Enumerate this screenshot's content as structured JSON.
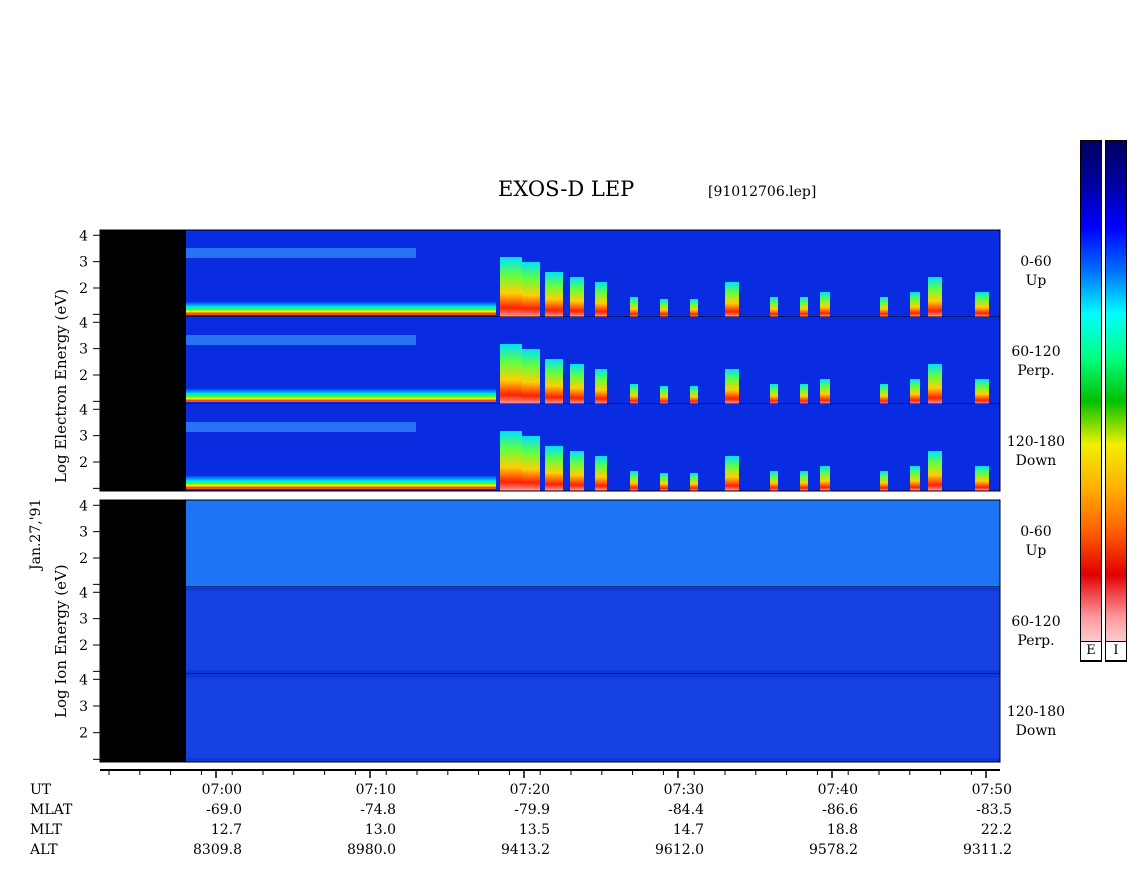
{
  "title": "EXOS-D LEP",
  "subtitle": "[91012706.lep]",
  "date_label": "Jan.27,'91",
  "electron_axis_label": "Log  Electron  Energy (eV)",
  "ion_axis_label": "Log  Ion  Energy (eV)",
  "colorbar_labels": [
    "E",
    "I"
  ],
  "colorbar_colors": [
    "#f5f5f5",
    "#ff9aa0",
    "#e00000",
    "#ff6000",
    "#ffb000",
    "#f0f000",
    "#00c000",
    "#00ff80",
    "#00ffff",
    "#0070ff",
    "#0000ff",
    "#0000a0",
    "#000060"
  ],
  "row_labels": [
    "UT",
    "MLAT",
    "MLT",
    "ALT"
  ],
  "ut_ticks": [
    "07:00",
    "07:10",
    "07:20",
    "07:30",
    "07:40",
    "07:50"
  ],
  "mlat": [
    "-69.0",
    "-74.8",
    "-79.9",
    "-84.4",
    "-86.6",
    "-83.5"
  ],
  "mlt": [
    "12.7",
    "13.0",
    "13.5",
    "14.7",
    "18.8",
    "22.2"
  ],
  "alt": [
    "8309.8",
    "8980.0",
    "9413.2",
    "9612.0",
    "9578.2",
    "9311.2"
  ],
  "chart_data": {
    "type": "heatmap",
    "title": "EXOS-D LEP",
    "subtitle": "[91012706.lep]",
    "xlabel": "UT",
    "x_ticks": [
      "07:00",
      "07:10",
      "07:20",
      "07:30",
      "07:40",
      "07:50"
    ],
    "y_ticks": [
      "1",
      "2",
      "3",
      "4"
    ],
    "panels": [
      {
        "species": "Electron",
        "pitch_angle": "0-60",
        "direction": "Up"
      },
      {
        "species": "Electron",
        "pitch_angle": "60-120",
        "direction": "Perp."
      },
      {
        "species": "Electron",
        "pitch_angle": "120-180",
        "direction": "Down"
      },
      {
        "species": "Ion",
        "pitch_angle": "0-60",
        "direction": "Up"
      },
      {
        "species": "Ion",
        "pitch_angle": "60-120",
        "direction": "Perp."
      },
      {
        "species": "Ion",
        "pitch_angle": "120-180",
        "direction": "Down"
      }
    ]
  }
}
